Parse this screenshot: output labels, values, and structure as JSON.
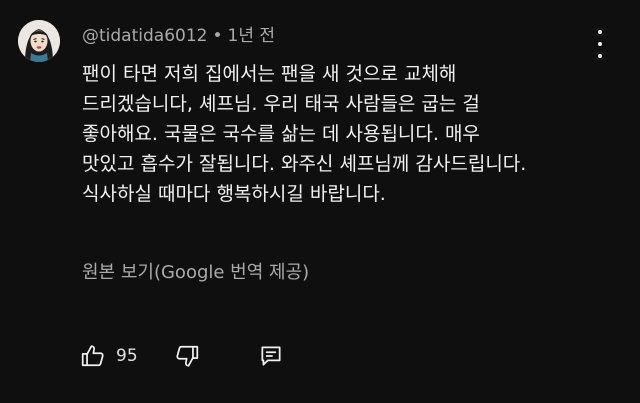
{
  "comment": {
    "author": "@tidatida6012",
    "separator": "•",
    "time": "1년 전",
    "body_lines": [
      "팬이 타면 저희 집에서는 팬을 새 것으로 교체해",
      "드리겠습니다, 셰프님.  우리 태국 사람들은 굽는 걸",
      "좋아해요. 국물은 국수를 삶는 데 사용됩니다. 매우",
      "맛있고 흡수가 잘됩니다. 와주신 셰프님께 감사드립니다.",
      "식사하실 때마다 행복하시길 바랍니다."
    ],
    "translate_link": "원본 보기(Google 번역 제공)",
    "like_count": "95"
  },
  "icons": {
    "menu": "vertical-dots-icon",
    "like": "thumbs-up-icon",
    "dislike": "thumbs-down-icon",
    "reply": "reply-icon"
  },
  "colors": {
    "background": "#0f0f0f",
    "text": "#f1f1f1",
    "secondary_text": "#aaaaaa"
  }
}
